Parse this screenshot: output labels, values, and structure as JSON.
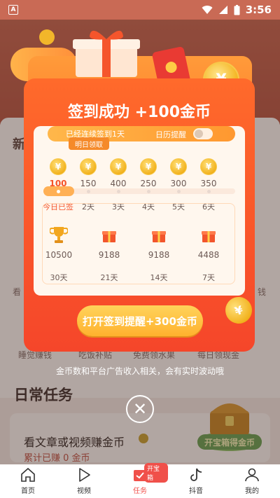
{
  "status_bar": {
    "time": "3:56",
    "notification_letter": "A"
  },
  "background": {
    "section_partial_title": "新",
    "partial_left_text": "看",
    "partial_right_text": "钱",
    "task_row_texts": [
      "睡觉赚钱",
      "吃饭补贴",
      "免费领水果",
      "每日领现金"
    ],
    "daily_tasks_title": "日常任务",
    "task": {
      "title": "看文章或视频赚金币",
      "subtitle": "累计已赚 0 金币"
    },
    "treasure_label": "开宝箱得金币"
  },
  "popup": {
    "title": "签到成功 +100金币",
    "streak_text": "已经连续签到1天",
    "calendar_reminder_label": "日历提醒",
    "tomorrow_tag": "明日领取",
    "coin_symbol": "¥",
    "small_rewards": [
      {
        "amount": "100",
        "day": "今日已签",
        "active": true
      },
      {
        "amount": "150",
        "day": "2天",
        "active": false
      },
      {
        "amount": "400",
        "day": "3天",
        "active": false
      },
      {
        "amount": "250",
        "day": "4天",
        "active": false
      },
      {
        "amount": "300",
        "day": "5天",
        "active": false
      },
      {
        "amount": "350",
        "day": "6天",
        "active": false
      }
    ],
    "big_rewards": [
      {
        "amount": "10500",
        "day": "30天",
        "icon": "trophy-icon"
      },
      {
        "amount": "9188",
        "day": "21天",
        "icon": "gift-icon"
      },
      {
        "amount": "9188",
        "day": "14天",
        "icon": "gift-icon"
      },
      {
        "amount": "4488",
        "day": "7天",
        "icon": "gift-icon"
      }
    ],
    "cta_label": "打开签到提醒+300金币",
    "disclaimer": "金币数和平台广告收入相关，会有实时波动哦",
    "close_symbol": "✕"
  },
  "nav": {
    "items": [
      {
        "label": "首页",
        "icon": "home-icon",
        "active": false
      },
      {
        "label": "视频",
        "icon": "play-icon",
        "active": false
      },
      {
        "label": "任务",
        "icon": "task-icon",
        "active": true,
        "badge": "开宝箱"
      },
      {
        "label": "抖音",
        "icon": "tiktok-icon",
        "active": false
      },
      {
        "label": "我的",
        "icon": "profile-icon",
        "active": false
      }
    ]
  },
  "colors": {
    "accent": "#f5462a",
    "gold": "#f2b21e",
    "nav_active": "#f0504a"
  }
}
